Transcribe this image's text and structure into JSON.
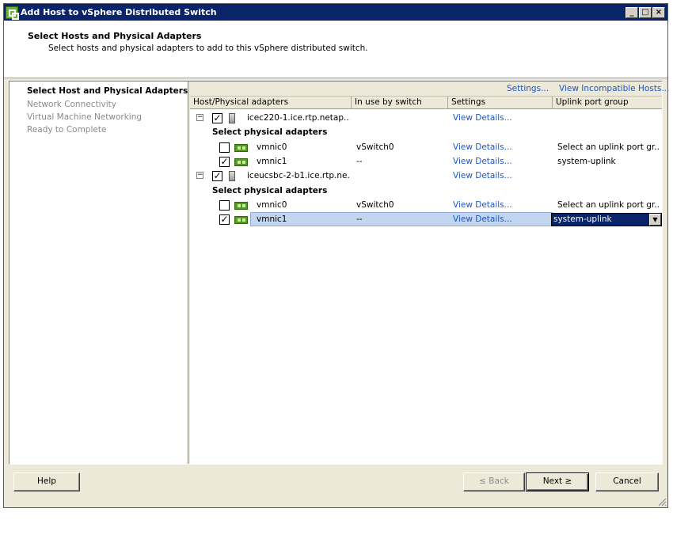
{
  "window": {
    "title": "Add Host to vSphere Distributed Switch",
    "controls": [
      "_",
      "□",
      "×"
    ]
  },
  "header": {
    "title": "Select Hosts and Physical Adapters",
    "subtitle": "Select hosts and physical adapters to add to this vSphere distributed switch."
  },
  "steps": [
    {
      "label": "Select Host and Physical Adapters",
      "state": "active"
    },
    {
      "label": "Network Connectivity",
      "state": "disabled"
    },
    {
      "label": "Virtual Machine Networking",
      "state": "disabled"
    },
    {
      "label": "Ready to Complete",
      "state": "disabled"
    }
  ],
  "links": {
    "settings": "Settings...",
    "incompatible": "View Incompatible Hosts..."
  },
  "columns": [
    "Host/Physical adapters",
    "In use by switch",
    "Settings",
    "Uplink port group"
  ],
  "rows": [
    {
      "kind": "host",
      "name": "icec220-1.ice.rtp.netap...",
      "checked": "✓",
      "expander": "−",
      "settings": "View Details..."
    },
    {
      "kind": "group",
      "label": "Select physical adapters"
    },
    {
      "kind": "nic",
      "name": "vmnic0",
      "checked": "",
      "switch": "vSwitch0",
      "settings": "View Details...",
      "uplink": "Select an uplink port gr..."
    },
    {
      "kind": "nic",
      "name": "vmnic1",
      "checked": "✓",
      "switch": "--",
      "settings": "View Details...",
      "uplink": "system-uplink"
    },
    {
      "kind": "host",
      "name": "iceucsbc-2-b1.ice.rtp.ne...",
      "checked": "✓",
      "expander": "−",
      "settings": "View Details..."
    },
    {
      "kind": "group",
      "label": "Select physical adapters"
    },
    {
      "kind": "nic",
      "name": "vmnic0",
      "checked": "",
      "switch": "vSwitch0",
      "settings": "View Details...",
      "uplink": "Select an uplink port gr..."
    },
    {
      "kind": "nic",
      "name": "vmnic1",
      "checked": "✓",
      "switch": "--",
      "settings": "View Details...",
      "uplink": "system-uplink",
      "selected": true,
      "dropdown_arrow": "▼"
    }
  ],
  "buttons": {
    "help": "Help",
    "back": "≤ Back",
    "next": "Next ≥",
    "cancel": "Cancel"
  },
  "colors": {
    "titlebar": "#0a246a",
    "link": "#1c56c7",
    "selection": "#c2d6f0"
  }
}
